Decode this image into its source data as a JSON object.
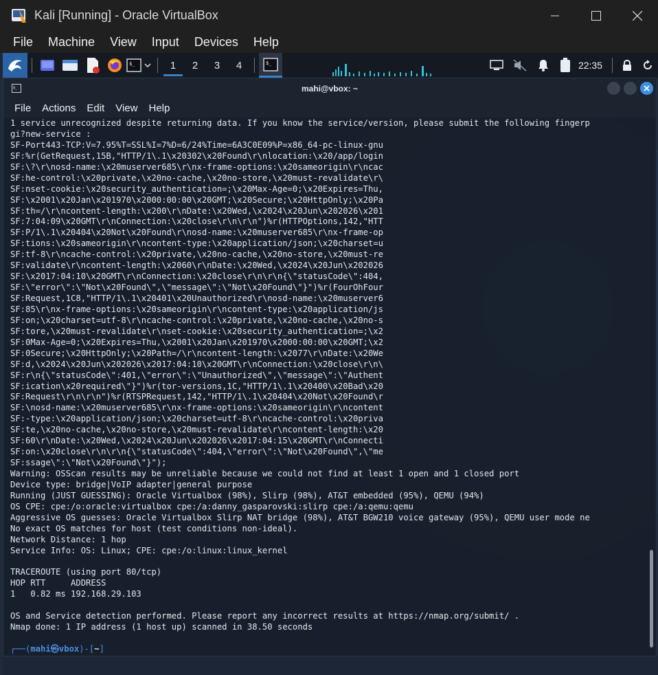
{
  "host": {
    "title": "Kali [Running] - Oracle VirtualBox",
    "menu": [
      "File",
      "Machine",
      "View",
      "Input",
      "Devices",
      "Help"
    ]
  },
  "panel": {
    "workspaces": [
      "1",
      "2",
      "3",
      "4"
    ],
    "active_workspace": "1",
    "clock": "22:35"
  },
  "terminal": {
    "title": "mahi@vbox: ~",
    "menu": [
      "File",
      "Actions",
      "Edit",
      "View",
      "Help"
    ],
    "lines": [
      "1 service unrecognized despite returning data. If you know the service/version, please submit the following fingerp",
      "gi?new-service :",
      "SF-Port443-TCP:V=7.95%T=SSL%I=7%D=6/24%Time=6A3C0E09%P=x86_64-pc-linux-gnu",
      "SF:%r(GetRequest,15B,\"HTTP/1\\.1\\x20302\\x20Found\\r\\nlocation:\\x20/app/login",
      "SF:\\?\\r\\nosd-name:\\x20muserver685\\r\\nx-frame-options:\\x20sameorigin\\r\\ncac",
      "SF:he-control:\\x20private,\\x20no-cache,\\x20no-store,\\x20must-revalidate\\r\\",
      "SF:nset-cookie:\\x20security_authentication=;\\x20Max-Age=0;\\x20Expires=Thu,",
      "SF:\\x2001\\x20Jan\\x201970\\x2000:00:00\\x20GMT;\\x20Secure;\\x20HttpOnly;\\x20Pa",
      "SF:th=/\\r\\ncontent-length:\\x200\\r\\nDate:\\x20Wed,\\x2024\\x20Jun\\x202026\\x201",
      "SF:7:04:09\\x20GMT\\r\\nConnection:\\x20close\\r\\n\\r\\n\")%r(HTTPOptions,142,\"HTT",
      "SF:P/1\\.1\\x20404\\x20Not\\x20Found\\r\\nosd-name:\\x20muserver685\\r\\nx-frame-op",
      "SF:tions:\\x20sameorigin\\r\\ncontent-type:\\x20application/json;\\x20charset=u",
      "SF:tf-8\\r\\ncache-control:\\x20private,\\x20no-cache,\\x20no-store,\\x20must-re",
      "SF:validate\\r\\ncontent-length:\\x2060\\r\\nDate:\\x20Wed,\\x2024\\x20Jun\\x202026",
      "SF:\\x2017:04:10\\x20GMT\\r\\nConnection:\\x20close\\r\\n\\r\\n{\\\"statusCode\\\":404,",
      "SF:\\\"error\\\":\\\"Not\\x20Found\\\",\\\"message\\\":\\\"Not\\x20Found\\\"}\")%r(FourOhFour",
      "SF:Request,1C8,\"HTTP/1\\.1\\x20401\\x20Unauthorized\\r\\nosd-name:\\x20muserver6",
      "SF:85\\r\\nx-frame-options:\\x20sameorigin\\r\\ncontent-type:\\x20application/js",
      "SF:on;\\x20charset=utf-8\\r\\ncache-control:\\x20private,\\x20no-cache,\\x20no-s",
      "SF:tore,\\x20must-revalidate\\r\\nset-cookie:\\x20security_authentication=;\\x2",
      "SF:0Max-Age=0;\\x20Expires=Thu,\\x2001\\x20Jan\\x201970\\x2000:00:00\\x20GMT;\\x2",
      "SF:0Secure;\\x20HttpOnly;\\x20Path=/\\r\\ncontent-length:\\x2077\\r\\nDate:\\x20We",
      "SF:d,\\x2024\\x20Jun\\x202026\\x2017:04:10\\x20GMT\\r\\nConnection:\\x20close\\r\\n\\",
      "SF:r\\n{\\\"statusCode\\\":401,\\\"error\\\":\\\"Unauthorized\\\",\\\"message\\\":\\\"Authent",
      "SF:ication\\x20required\\\"}\")%r(tor-versions,1C,\"HTTP/1\\.1\\x20400\\x20Bad\\x20",
      "SF:Request\\r\\n\\r\\n\")%r(RTSPRequest,142,\"HTTP/1\\.1\\x20404\\x20Not\\x20Found\\r",
      "SF:\\nosd-name:\\x20muserver685\\r\\nx-frame-options:\\x20sameorigin\\r\\ncontent",
      "SF:-type:\\x20application/json;\\x20charset=utf-8\\r\\ncache-control:\\x20priva",
      "SF:te,\\x20no-cache,\\x20no-store,\\x20must-revalidate\\r\\ncontent-length:\\x20",
      "SF:60\\r\\nDate:\\x20Wed,\\x2024\\x20Jun\\x202026\\x2017:04:15\\x20GMT\\r\\nConnecti",
      "SF:on:\\x20close\\r\\n\\r\\n{\\\"statusCode\\\":404,\\\"error\\\":\\\"Not\\x20Found\\\",\\\"me",
      "SF:ssage\\\":\\\"Not\\x20Found\\\"}\");",
      "Warning: OSScan results may be unreliable because we could not find at least 1 open and 1 closed port",
      "Device type: bridge|VoIP adapter|general purpose",
      "Running (JUST GUESSING): Oracle Virtualbox (98%), Slirp (98%), AT&T embedded (95%), QEMU (94%)",
      "OS CPE: cpe:/o:oracle:virtualbox cpe:/a:danny_gasparovski:slirp cpe:/a:qemu:qemu",
      "Aggressive OS guesses: Oracle Virtualbox Slirp NAT bridge (98%), AT&T BGW210 voice gateway (95%), QEMU user mode ne",
      "No exact OS matches for host (test conditions non-ideal).",
      "Network Distance: 1 hop",
      "Service Info: OS: Linux; CPE: cpe:/o:linux:linux_kernel",
      "",
      "TRACEROUTE (using port 80/tcp)",
      "HOP RTT     ADDRESS",
      "1   0.82 ms 192.168.29.103",
      "",
      "OS and Service detection performed. Please report any incorrect results at https://nmap.org/submit/ .",
      "Nmap done: 1 IP address (1 host up) scanned in 38.50 seconds",
      ""
    ],
    "prompt": {
      "prefix": "┌──(",
      "user": "mahi㉿vbox",
      "mid": ")-[",
      "dir": "~",
      "suffix": "]"
    }
  }
}
